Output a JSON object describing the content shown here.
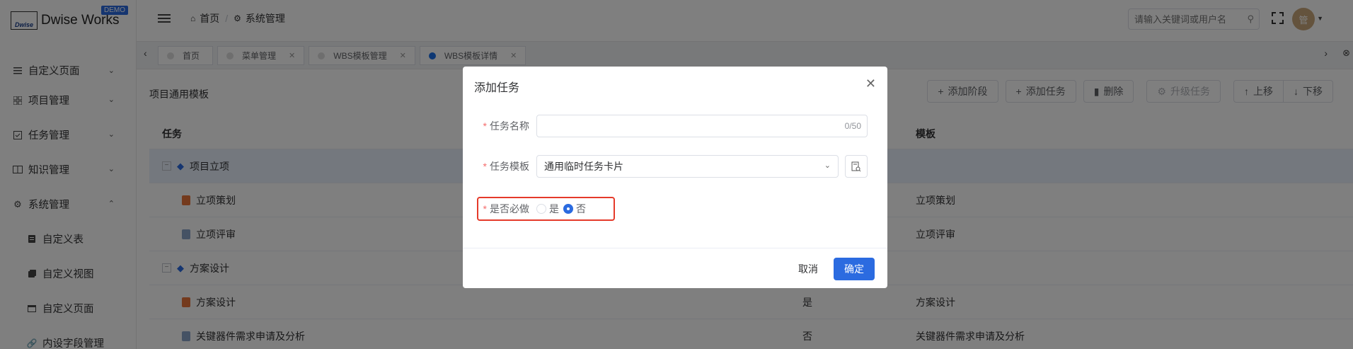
{
  "app": {
    "logo_mark": "Dwise",
    "name": "Dwise Works",
    "badge": "DEMO"
  },
  "sidebar": {
    "items": [
      {
        "label": "自定义页面"
      },
      {
        "label": "项目管理"
      },
      {
        "label": "任务管理"
      },
      {
        "label": "知识管理"
      },
      {
        "label": "系统管理"
      }
    ],
    "sub_items": [
      {
        "label": "自定义表"
      },
      {
        "label": "自定义视图"
      },
      {
        "label": "自定义页面"
      },
      {
        "label": "内设字段管理"
      }
    ]
  },
  "header": {
    "breadcrumb": [
      "首页",
      "系统管理"
    ],
    "search_placeholder": "请输入关键词或用户名",
    "avatar_text": "管"
  },
  "tabs": [
    {
      "label": "首页"
    },
    {
      "label": "菜单管理"
    },
    {
      "label": "WBS模板管理"
    },
    {
      "label": "WBS模板详情"
    }
  ],
  "content": {
    "title": "项目通用模板",
    "actions": [
      "添加阶段",
      "添加任务",
      "删除",
      "升级任务",
      "上移",
      "下移"
    ],
    "columns": [
      "任务",
      "",
      "模板"
    ],
    "rows": [
      {
        "name": "项目立项",
        "required": "",
        "template": ""
      },
      {
        "name": "立项策划",
        "required": "",
        "template": "立项策划"
      },
      {
        "name": "立项评审",
        "required": "",
        "template": "立项评审"
      },
      {
        "name": "方案设计",
        "required": "",
        "template": ""
      },
      {
        "name": "方案设计",
        "required": "是",
        "template": "方案设计"
      },
      {
        "name": "关键器件需求申请及分析",
        "required": "否",
        "template": "关键器件需求申请及分析"
      }
    ]
  },
  "modal": {
    "title": "添加任务",
    "task_name_label": "任务名称",
    "task_name_value": "",
    "task_name_counter": "0/50",
    "template_label": "任务模板",
    "template_value": "通用临时任务卡片",
    "required_label": "是否必做",
    "opt_yes": "是",
    "opt_no": "否",
    "cancel": "取消",
    "confirm": "确定"
  }
}
